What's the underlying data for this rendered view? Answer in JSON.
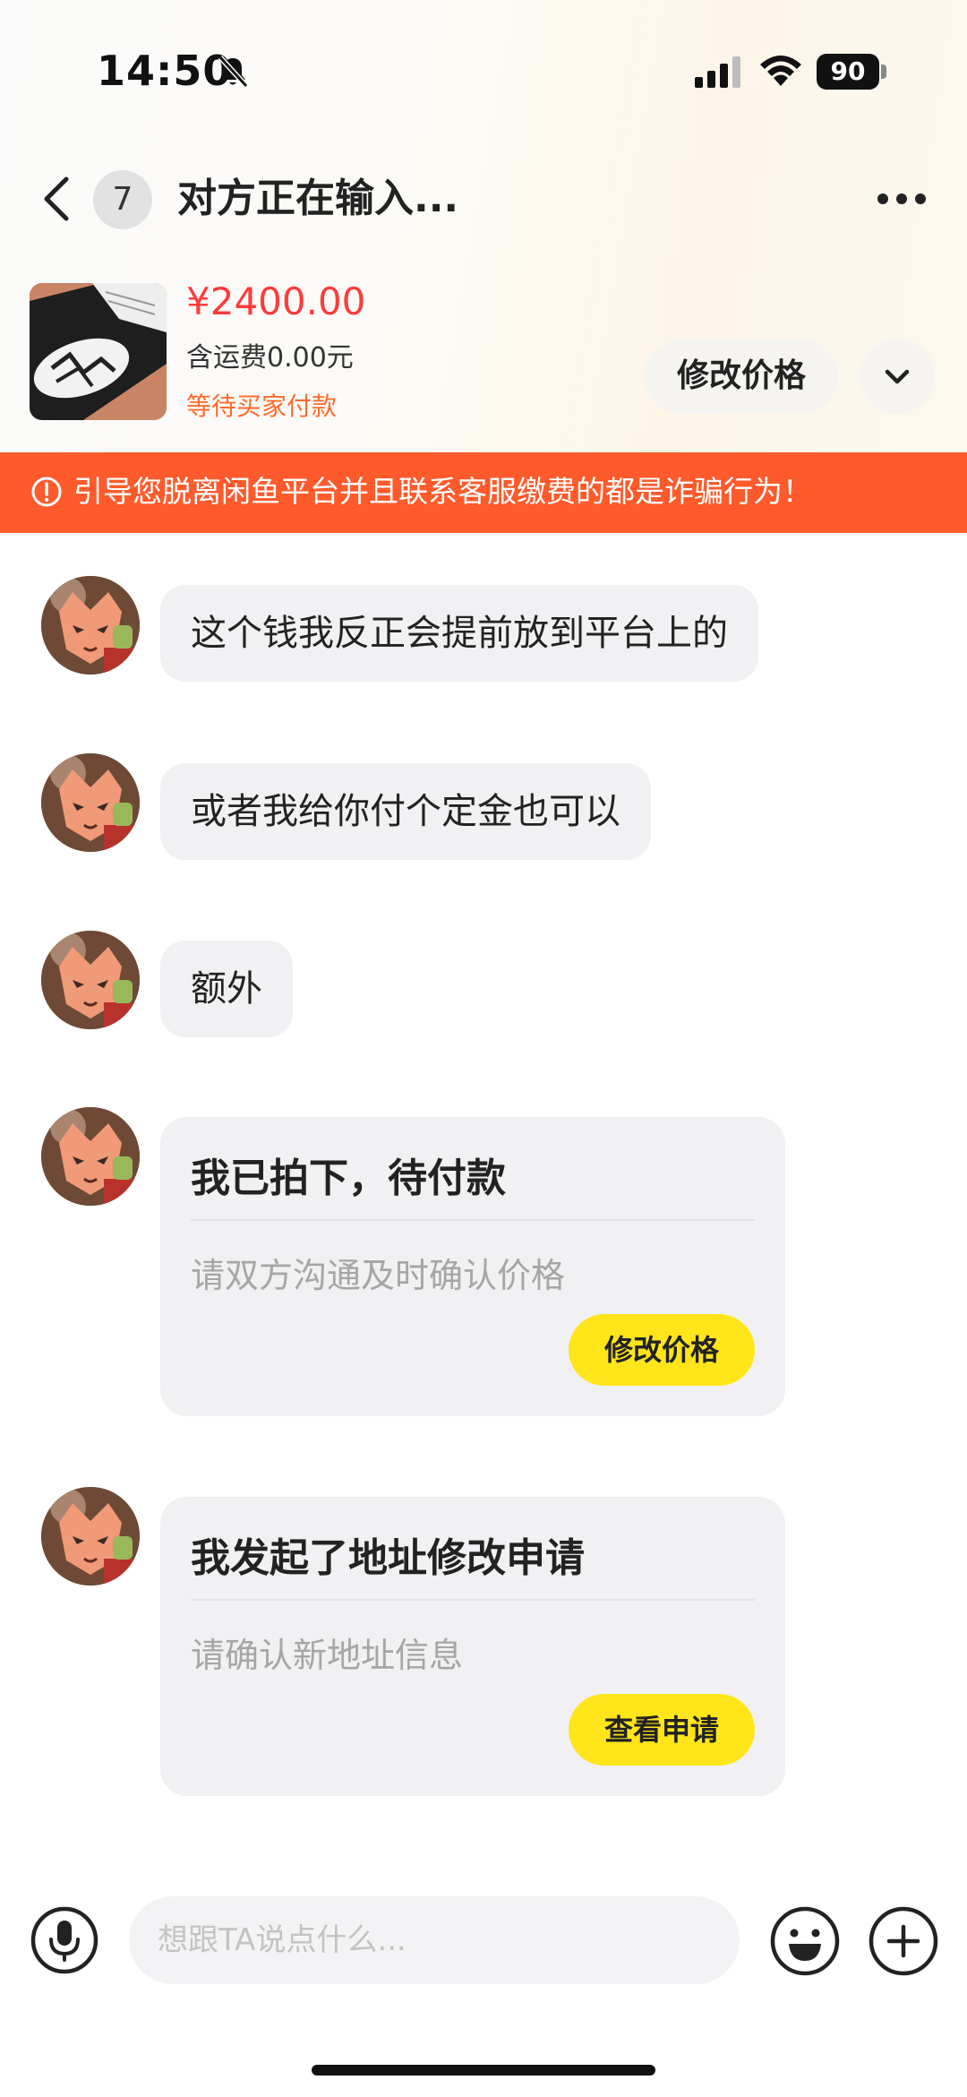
{
  "status_bar": {
    "time": "14:50",
    "battery": "90",
    "icons": [
      "bell-off-icon",
      "signal-icon",
      "wifi-icon",
      "battery-icon"
    ]
  },
  "header": {
    "unread_count": "7",
    "title": "对方正在输入...",
    "icons": [
      "chevron-left-icon",
      "more-icon"
    ]
  },
  "product": {
    "price": "¥2400.00",
    "shipping": "含运费0.00元",
    "status": "等待买家付款",
    "modify_price_label": "修改价格",
    "price_color": "#ff3b3b"
  },
  "warning": {
    "text": "引导您脱离闲鱼平台并且联系客服缴费的都是诈骗行为！",
    "color": "#ff5a2b"
  },
  "messages": [
    {
      "type": "text",
      "text": "这个钱我反正会提前放到平台上的"
    },
    {
      "type": "text",
      "text": "或者我给你付个定金也可以"
    },
    {
      "type": "text",
      "text": "额外"
    },
    {
      "type": "card",
      "title": "我已拍下，待付款",
      "subtitle": "请双方沟通及时确认价格",
      "button": "修改价格"
    },
    {
      "type": "card",
      "title": "我发起了地址修改申请",
      "subtitle": "请确认新地址信息",
      "button": "查看申请"
    }
  ],
  "input_bar": {
    "placeholder": "想跟TA说点什么...",
    "icons": [
      "microphone-icon",
      "emoji-icon",
      "plus-icon"
    ]
  },
  "accent_yellow": "#ffe51a"
}
